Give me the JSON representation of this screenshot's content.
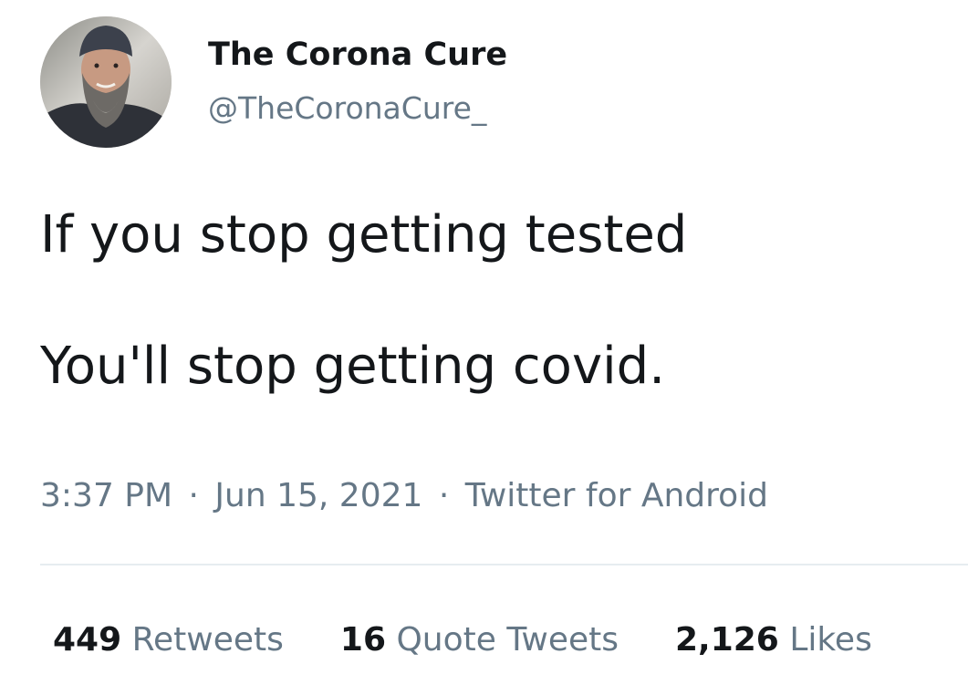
{
  "author": {
    "display_name": "The Corona Cure",
    "handle": "@TheCoronaCure_"
  },
  "tweet": {
    "lines": [
      "If you stop getting tested",
      "You'll stop getting covid."
    ]
  },
  "meta": {
    "time": "3:37 PM",
    "separator": "·",
    "date": "Jun 15, 2021",
    "source": "Twitter for Android"
  },
  "stats": {
    "retweets": {
      "count": "449",
      "label": "Retweets"
    },
    "quotes": {
      "count": "16",
      "label": "Quote Tweets"
    },
    "likes": {
      "count": "2,126",
      "label": "Likes"
    }
  },
  "colors": {
    "text_primary": "#14171a",
    "text_secondary": "#657786",
    "divider": "#e6ecf0"
  }
}
